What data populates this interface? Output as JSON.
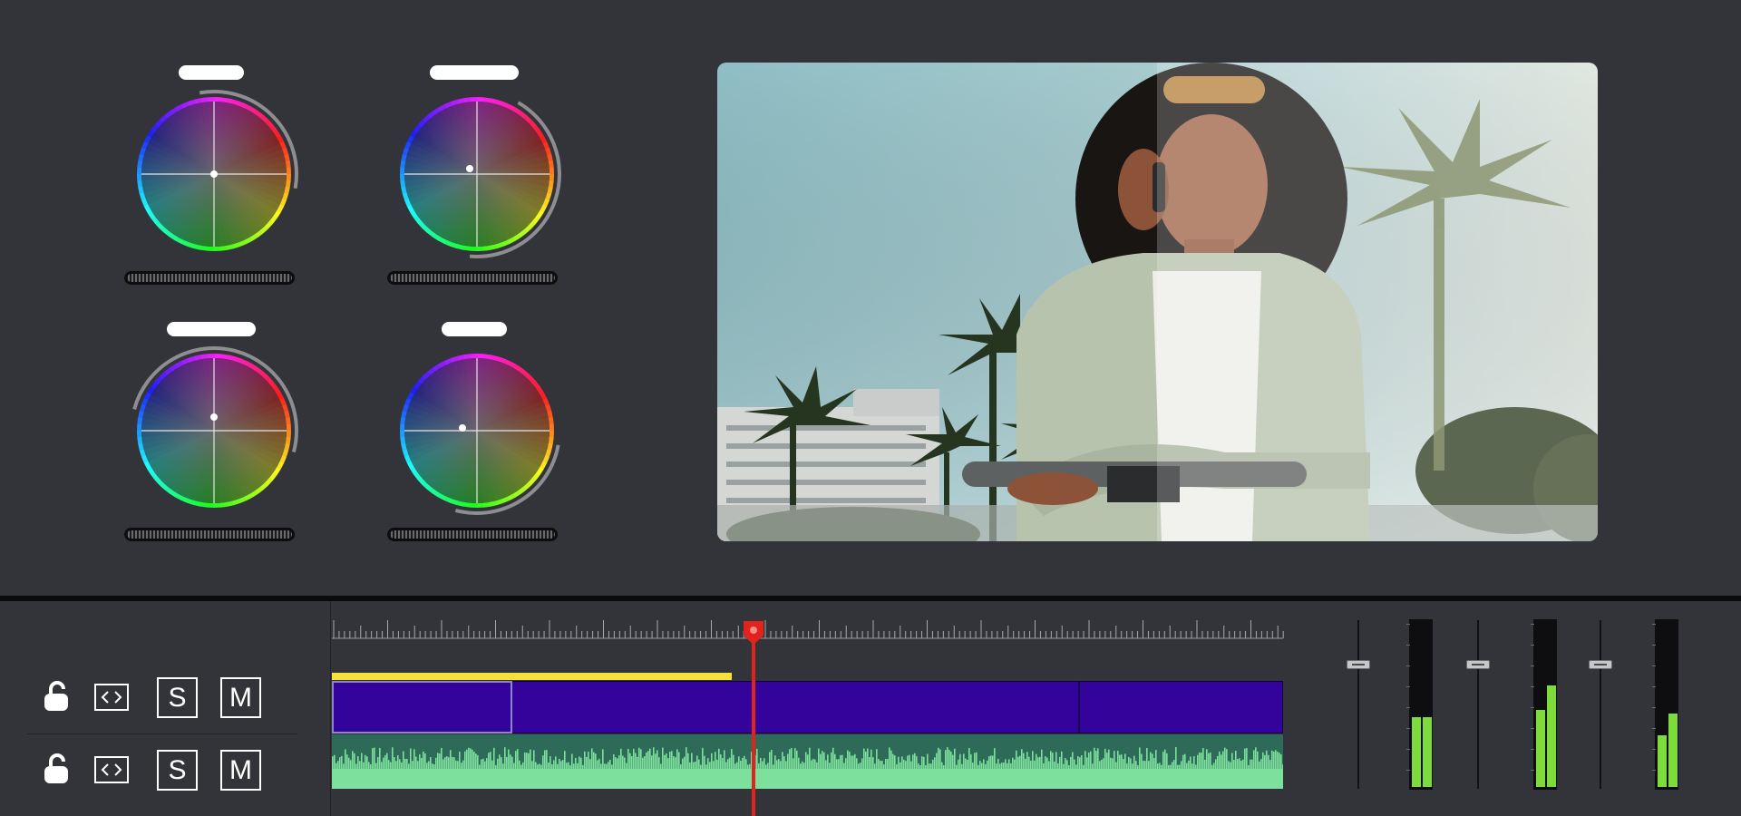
{
  "color_wheels": [
    {
      "name_pill_visible": true,
      "indicator_icon": "puck",
      "label": ""
    },
    {
      "name_pill_visible": true,
      "indicator_icon": "puck",
      "label": ""
    },
    {
      "name_pill_visible": true,
      "indicator_icon": "puck",
      "label": ""
    },
    {
      "name_pill_visible": true,
      "indicator_icon": "puck",
      "label": ""
    }
  ],
  "preview": {
    "icon": "video-frame",
    "split_compare": true
  },
  "tracks": [
    {
      "lock_icon": "unlocked-icon",
      "expand_icon": "code-brackets-icon",
      "solo_label": "S",
      "mute_label": "M"
    },
    {
      "lock_icon": "unlocked-icon",
      "expand_icon": "code-brackets-icon",
      "solo_label": "S",
      "mute_label": "M"
    }
  ],
  "timeline": {
    "playhead_color": "#e0231e",
    "video_clip_color": "#33039c",
    "audio_color": "#7de09c",
    "progress_color": "#f4e139",
    "progress_fraction": 0.42
  },
  "mixer": {
    "channels": [
      {
        "fader_icon": "fader-icon",
        "meter_levels": [
          0.42,
          0.42
        ]
      },
      {
        "fader_icon": "fader-icon",
        "meter_levels": [
          0.46,
          0.61
        ]
      },
      {
        "fader_icon": "fader-icon",
        "meter_levels": [
          0.31,
          0.44
        ]
      }
    ],
    "meter_color": "#7ddc3c"
  }
}
